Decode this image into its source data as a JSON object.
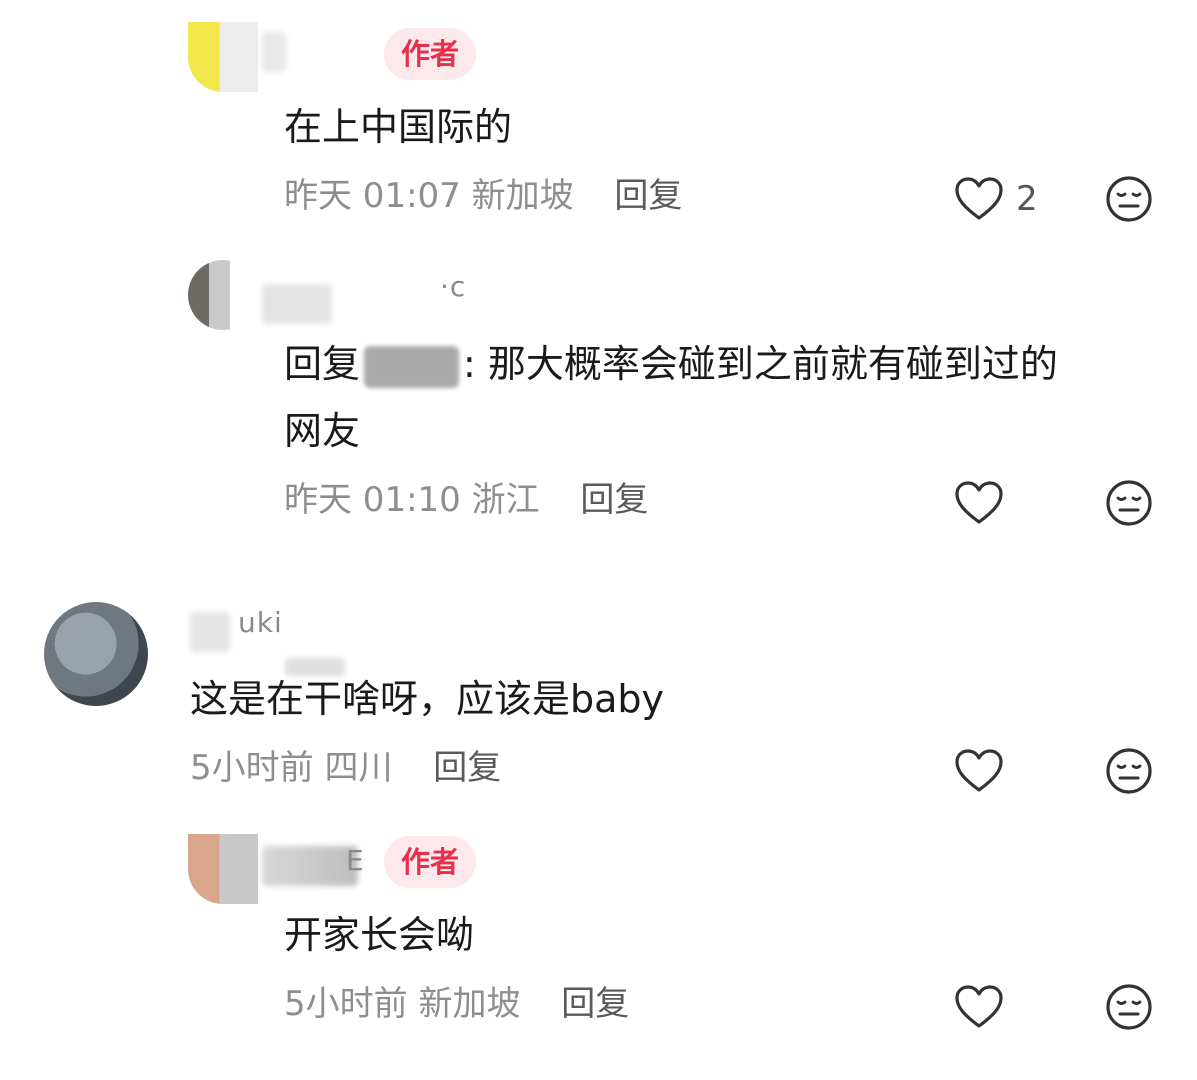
{
  "comments": [
    {
      "author_badge": "作者",
      "text": "在上中国际的",
      "time": "昨天 01:07",
      "location": "新加坡",
      "reply_label": "回复",
      "like_count": "2"
    },
    {
      "name_fragment": "·c",
      "text_prefix": "回复",
      "text_suffix": ": 那大概率会碰到之前就有碰到过的",
      "text_line2": "网友",
      "time": "昨天 01:10",
      "location": "浙江",
      "reply_label": "回复"
    },
    {
      "name_fragment": "uki",
      "text": "这是在干啥呀，应该是baby",
      "time": "5小时前",
      "location": "四川",
      "reply_label": "回复"
    },
    {
      "name_fragment": "E",
      "author_badge": "作者",
      "text": "开家长会呦",
      "time": "5小时前",
      "location": "新加坡",
      "reply_label": "回复"
    }
  ],
  "icons": {
    "like": "heart-outline-icon",
    "dislike": "neutral-face-icon"
  },
  "colors": {
    "badge_bg": "#fde9ec",
    "badge_text": "#e5304c",
    "meta_text": "#8e8e8e"
  }
}
